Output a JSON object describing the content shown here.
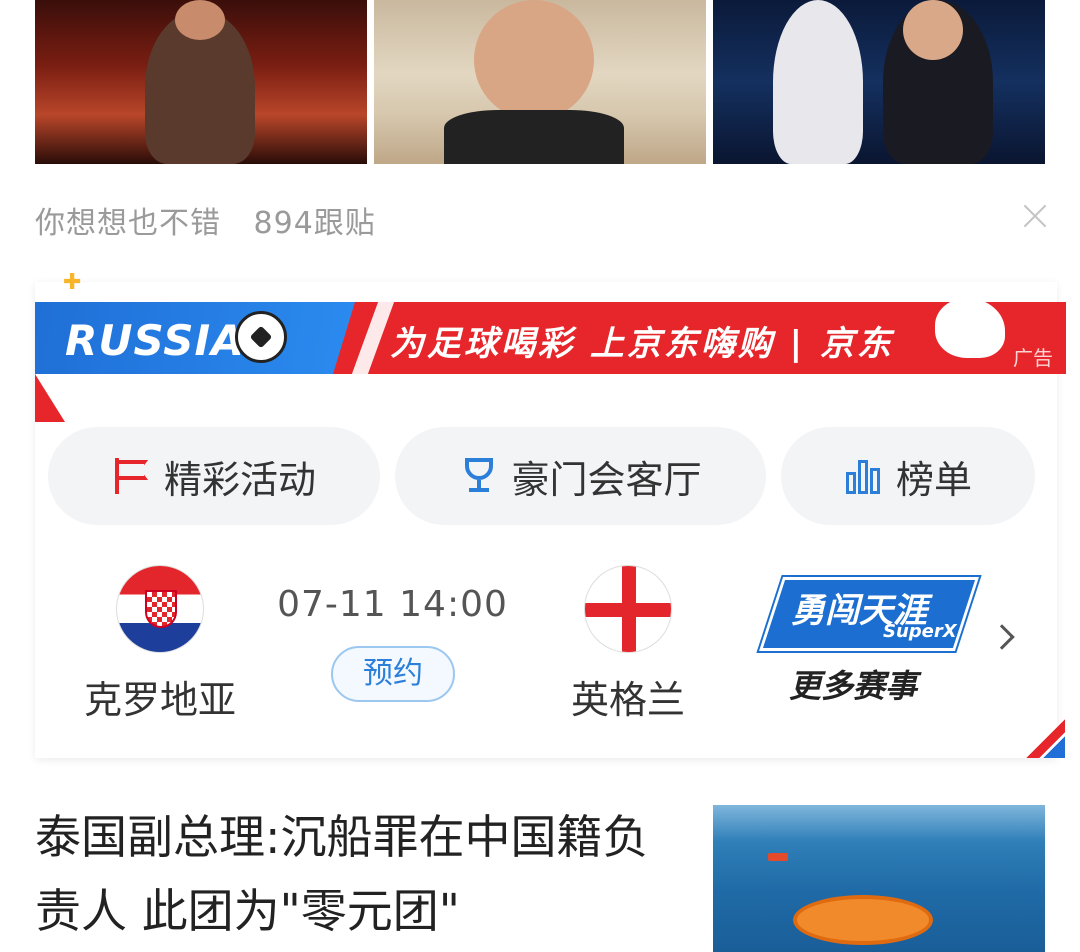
{
  "feed_item": {
    "source": "你想想也不错",
    "comments": "894跟贴"
  },
  "ad": {
    "brand_left": "RUSSIA",
    "slogan": "为足球喝彩 上京东嗨购 | 京东",
    "ad_tag": "广告",
    "pills": [
      {
        "label": "精彩活动",
        "icon": "flag-icon"
      },
      {
        "label": "豪门会客厅",
        "icon": "trophy-icon"
      },
      {
        "label": "榜单",
        "icon": "bar-chart-icon"
      }
    ],
    "match": {
      "home_team": "克罗地亚",
      "away_team": "英格兰",
      "time": "07-11 14:00",
      "reserve_label": "预约"
    },
    "sponsor": {
      "title": "勇闯天涯",
      "subtitle": "SuperX",
      "more_label": "更多赛事"
    }
  },
  "news": {
    "title": "泰国副总理:沉船罪在中国籍负责人 此团为\"零元团\""
  },
  "colors": {
    "accent_red": "#e6262a",
    "accent_blue": "#2b7fd9",
    "meta_gray": "#9a9a9a"
  }
}
